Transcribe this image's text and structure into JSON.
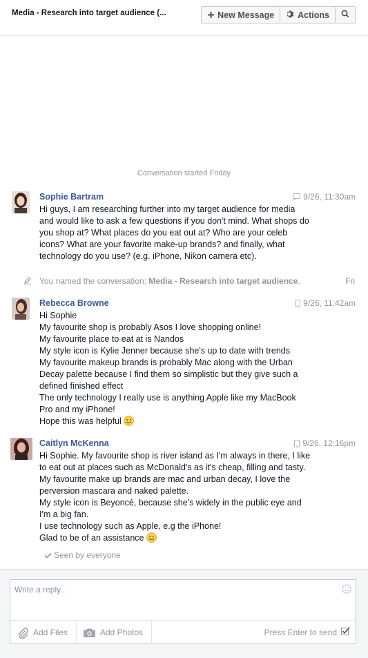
{
  "header": {
    "title": "Media - Research into target audience  (...",
    "new_message_label": "New Message",
    "actions_label": "Actions",
    "icons": {
      "new": "plus-icon",
      "actions": "gear-icon",
      "search": "search-icon"
    }
  },
  "conversation": {
    "started_text": "Conversation started Friday",
    "messages": [
      {
        "sender": "Sophie Bartram",
        "time": "9/26, 11:30am",
        "source_icon": "chat-bubble-icon",
        "lines": [
          "Hi guys, I am researching further into my target audience for media",
          "and would like to ask a few questions if you don't mind. What shops do",
          "you shop at? What places do you eat out at? Who are your celeb",
          "icons? What are your favorite make-up brands? and finally, what",
          "technology do you use? (e.g. iPhone, Nikon camera etc)."
        ]
      },
      {
        "sender": "Rebecca Browne",
        "time": "9/26, 11:42am",
        "source_icon": "mobile-phone-icon",
        "lines": [
          "Hi Sophie",
          "My favourite shop is probably Asos I love shopping online!",
          "My favourite place to eat at is Nandos",
          "My style icon is Kylie Jenner because she's up to date with trends",
          "My favourite makeup brands is probably Mac along with the Urban",
          "Decay palette because I find them so simplistic but they give such a",
          "defined finished effect",
          "The only technology I really use is anything Apple like my MacBook",
          "Pro and my iPhone!",
          "Hope this was helpful"
        ]
      },
      {
        "sender": "Caitlyn McKenna",
        "time": "9/26, 12:16pm",
        "source_icon": "mobile-phone-icon",
        "lines": [
          "Hi Sophie. My favourite shop is river island as I'm always in there, I like",
          "to eat out at places such as McDonald's as it's cheap, filling and tasty.",
          "My favourite make up brands are mac and urban decay, I love the",
          "perversion mascara and naked palette.",
          "My style icon is Beyoncé, because she's widely in the public eye and",
          "I'm a big fan.",
          "I use technology such as Apple, e.g the iPhone!",
          "Glad to be of an assistance"
        ]
      }
    ],
    "rename_event": {
      "prefix": "You named the conversation: ",
      "name": "Media - Research into target audience",
      "suffix": ".",
      "when": "Fri"
    },
    "seen_text": "Seen by everyone"
  },
  "composer": {
    "placeholder": "Write a reply...",
    "add_files_label": "Add Files",
    "add_photos_label": "Add Photos",
    "press_enter_label": "Press Enter to send",
    "press_enter_checked": true
  },
  "colors": {
    "link": "#3b5998",
    "muted": "#90949c",
    "text": "#141823",
    "composer_bg": "#f5f6f7"
  }
}
